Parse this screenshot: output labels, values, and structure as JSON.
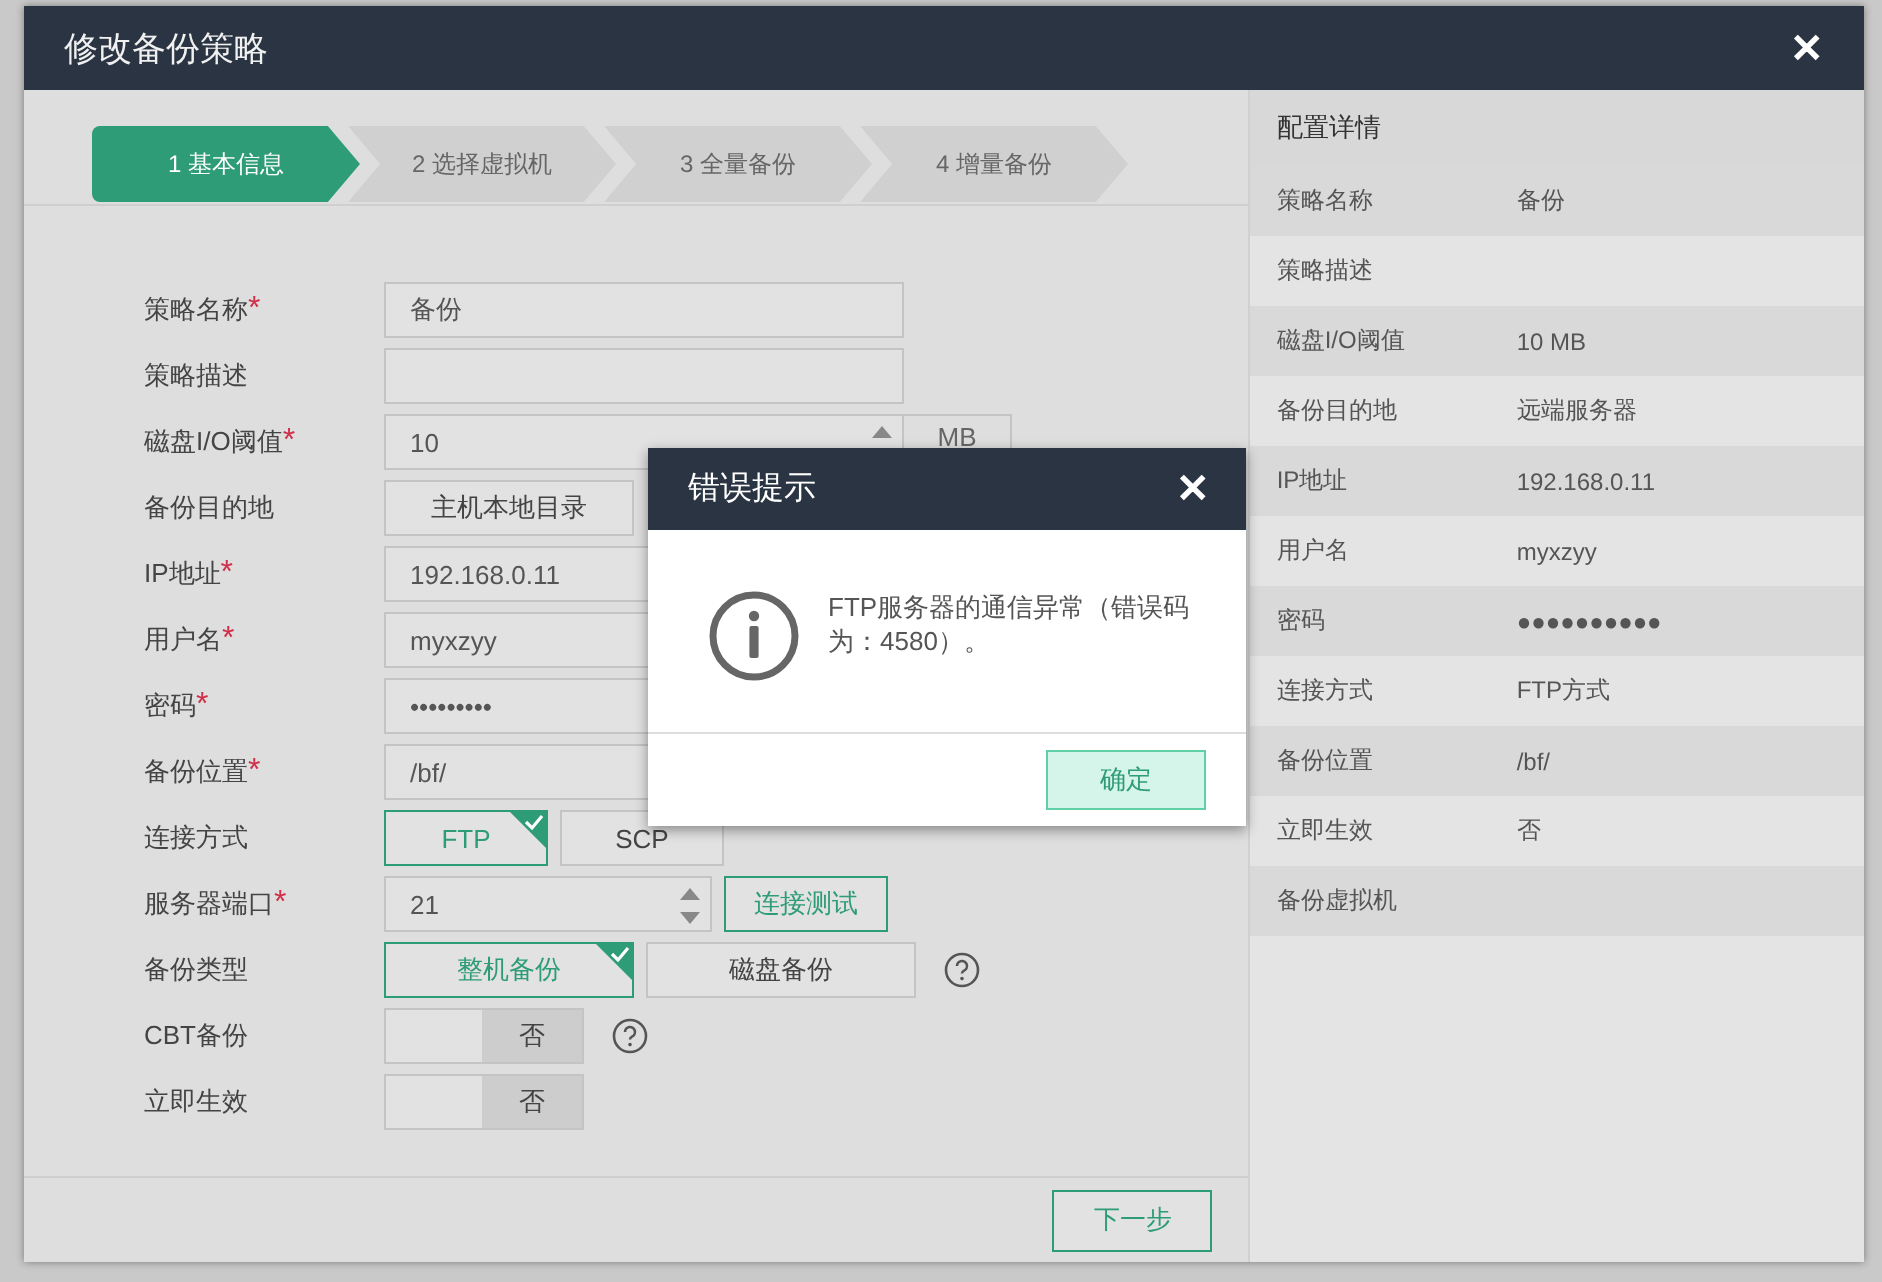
{
  "window": {
    "title": "修改备份策略",
    "close": "✕"
  },
  "steps": [
    {
      "label": "1 基本信息",
      "selected": true
    },
    {
      "label": "2 选择虚拟机",
      "selected": false
    },
    {
      "label": "3 全量备份",
      "selected": false
    },
    {
      "label": "4 增量备份",
      "selected": false
    }
  ],
  "form": {
    "required_mark": "*",
    "fields": [
      {
        "kind": "text",
        "label": "策略名称",
        "required": true,
        "value": "备份"
      },
      {
        "kind": "text",
        "label": "策略描述",
        "required": false
      },
      {
        "kind": "number",
        "label": "磁盘I/O阈值",
        "required": true,
        "value": "10",
        "unit": "MB"
      },
      {
        "kind": "choice",
        "label": "备份目的地",
        "required": false,
        "options": [
          {
            "label": "主机本地目录",
            "selected": false
          }
        ]
      },
      {
        "kind": "text",
        "label": "IP地址",
        "required": true,
        "value": "192.168.0.11"
      },
      {
        "kind": "text",
        "label": "用户名",
        "required": true,
        "value": "myxzyy"
      },
      {
        "kind": "text",
        "label": "密码",
        "required": true,
        "value": "•••••••••"
      },
      {
        "kind": "text",
        "label": "备份位置",
        "required": true,
        "value": "/bf/"
      },
      {
        "kind": "choice",
        "label": "连接方式",
        "required": false,
        "options": [
          {
            "label": "FTP",
            "selected": true
          },
          {
            "label": "SCP",
            "selected": false
          }
        ]
      },
      {
        "kind": "port",
        "label": "服务器端口",
        "required": true,
        "value": "21",
        "action": "连接测试"
      },
      {
        "kind": "choice",
        "label": "备份类型",
        "required": false,
        "help": true,
        "options": [
          {
            "label": "整机备份",
            "selected": true
          },
          {
            "label": "磁盘备份",
            "selected": false
          }
        ]
      },
      {
        "kind": "toggle",
        "label": "CBT备份",
        "required": false,
        "help": true,
        "on": false,
        "value": "否"
      },
      {
        "kind": "toggle",
        "label": "立即生效",
        "required": false,
        "on": false,
        "value": "否"
      }
    ]
  },
  "next_button": "下一步",
  "details": {
    "title": "配置详情",
    "rows": [
      {
        "label": "策略名称",
        "value": "备份"
      },
      {
        "label": "策略描述"
      },
      {
        "label": "磁盘I/O阈值",
        "value": "10 MB"
      },
      {
        "label": "备份目的地",
        "value": "远端服务器"
      },
      {
        "label": "IP地址",
        "value": "192.168.0.11"
      },
      {
        "label": "用户名",
        "value": "myxzyy"
      },
      {
        "label": "密码",
        "value": "●●●●●●●●●●"
      },
      {
        "label": "连接方式",
        "value": "FTP方式"
      },
      {
        "label": "备份位置",
        "value": "/bf/"
      },
      {
        "label": "立即生效",
        "value": "否"
      },
      {
        "label": "备份虚拟机"
      }
    ]
  },
  "error_dialog": {
    "title": "错误提示",
    "close": "✕",
    "message": "FTP服务器的通信异常（错误码为：4580）。",
    "button": "确定"
  }
}
